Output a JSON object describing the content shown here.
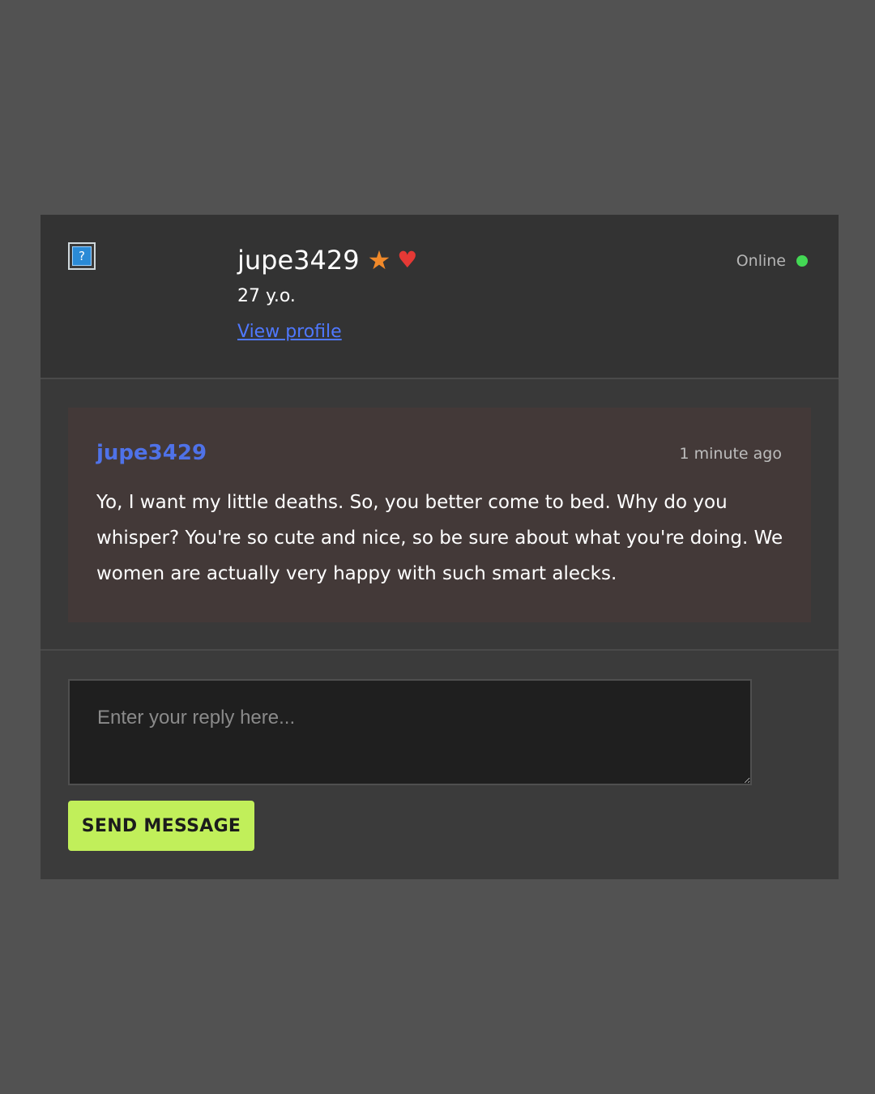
{
  "profile": {
    "avatar_glyph": "?",
    "username": "jupe3429",
    "star_icon": "★",
    "heart_icon": "♥",
    "age": "27 y.o.",
    "view_profile_label": "View profile",
    "status_label": "Online"
  },
  "message": {
    "author": "jupe3429",
    "time": "1 minute ago",
    "body": "Yo, I want my little deaths. So, you better come to bed. Why do you whisper? You're so cute and nice, so be sure about what you're doing. We women are actually very happy with such smart alecks."
  },
  "reply": {
    "placeholder": "Enter your reply here...",
    "send_label": "SEND MESSAGE"
  },
  "colors": {
    "page_bg": "#525252",
    "link": "#4f78ff",
    "author": "#4f72e8",
    "star": "#f0892a",
    "heart": "#e53935",
    "online_dot": "#43d854",
    "send_button": "#c1ef5a",
    "message_bg": "#433938"
  }
}
